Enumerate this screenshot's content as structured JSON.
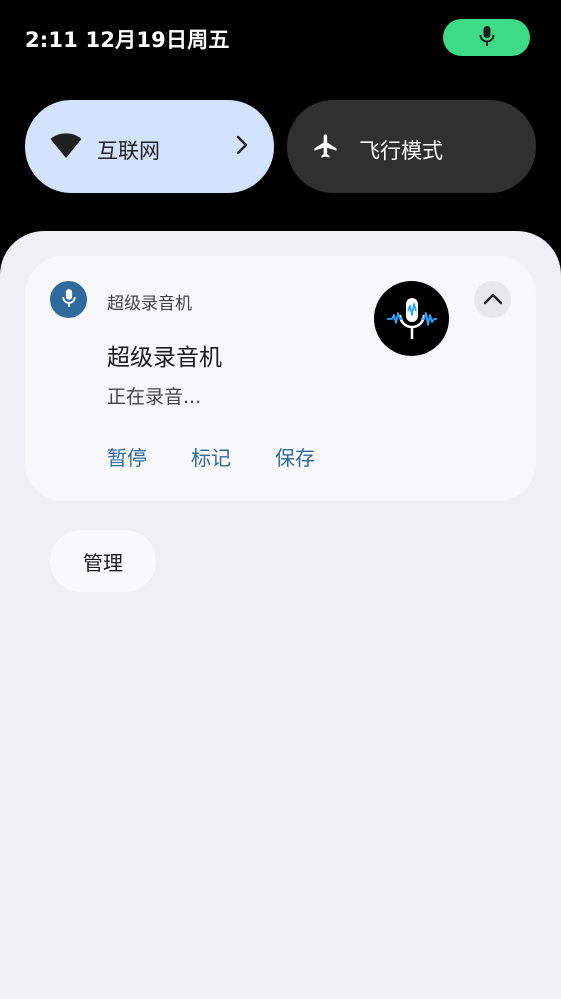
{
  "status_bar": {
    "datetime": "2:11 12月19日周五",
    "mic_indicator_icon": "microphone-icon",
    "mic_indicator_color": "#3ddc84"
  },
  "quick_tiles": {
    "internet": {
      "label": "互联网",
      "icon": "wifi-icon",
      "chevron_icon": "chevron-right-icon",
      "state": "on",
      "color": "#d3e3fd"
    },
    "airplane": {
      "label": "飞行模式",
      "icon": "airplane-icon",
      "state": "off",
      "color": "#303030"
    }
  },
  "notification": {
    "app_name": "超级录音机",
    "app_icon": "microphone-icon",
    "title": "超级录音机",
    "text": "正在录音...",
    "large_icon": "recording-mic-waveform-icon",
    "expand_icon": "chevron-up-icon",
    "actions": [
      "暂停",
      "标记",
      "保存"
    ],
    "accent_color": "#2f6a9d"
  },
  "manage_button": {
    "label": "管理"
  }
}
